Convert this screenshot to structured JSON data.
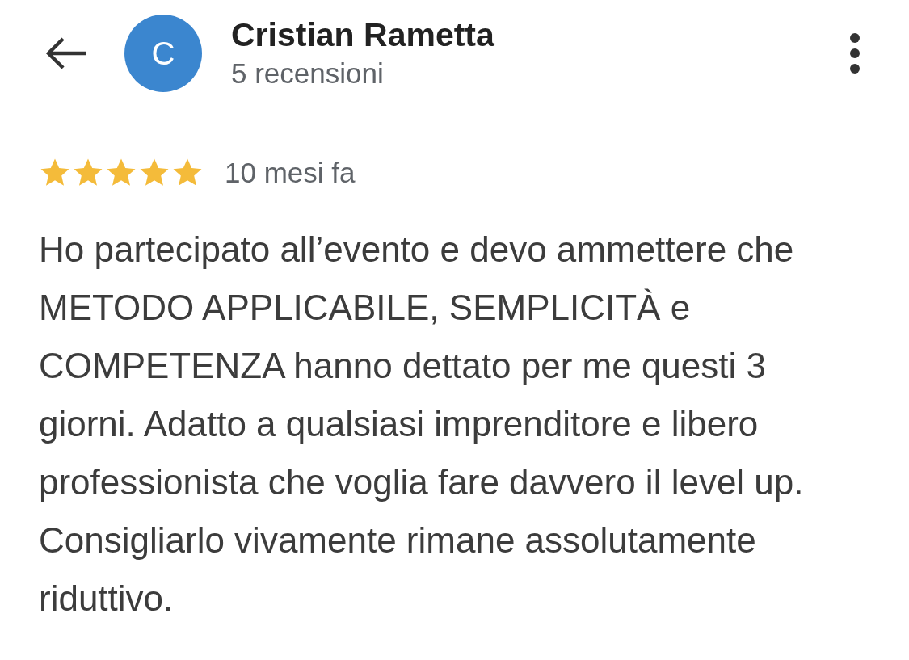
{
  "header": {
    "avatar_letter": "C",
    "name": "Cristian Rametta",
    "subtitle": "5 recensioni"
  },
  "review": {
    "stars": 5,
    "time": "10 mesi fa",
    "text": "Ho partecipato all’evento e devo ammettere che METODO APPLICABILE, SEMPLICITÀ e COMPETENZA hanno dettato per me questi 3 giorni. Adatto a qualsiasi imprenditore e libero professionista che voglia fare davvero il level up. Consigliarlo vivamente rimane assolutamente riduttivo."
  }
}
